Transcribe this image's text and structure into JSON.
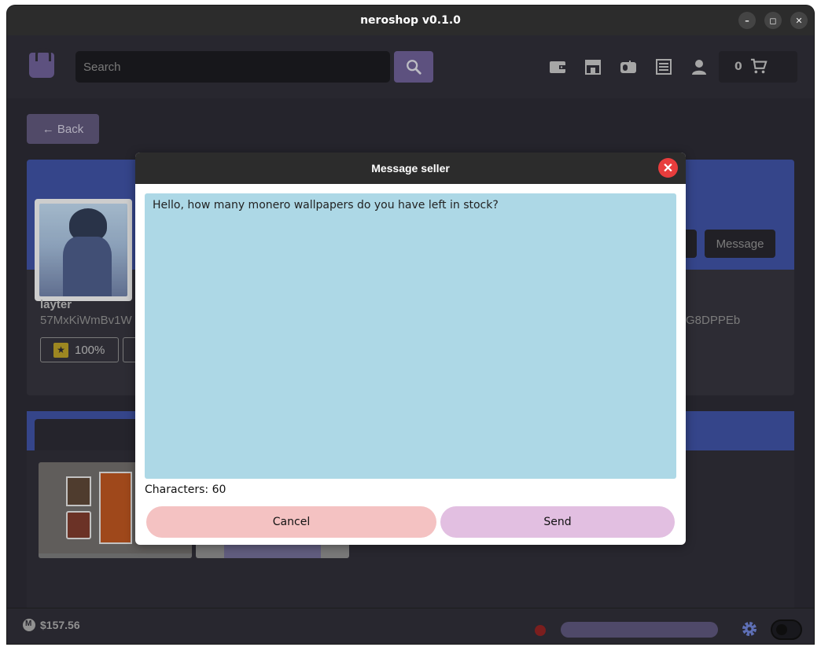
{
  "window": {
    "title": "neroshop v0.1.0",
    "controls": {
      "minimize": "–",
      "maximize": "◻",
      "close": "✕"
    }
  },
  "header": {
    "search_placeholder": "Search",
    "search_value": "",
    "cart_count": "0",
    "icons": [
      "wallet-icon",
      "store-icon",
      "mailbox-icon",
      "orders-icon",
      "account-icon",
      "cart-icon"
    ]
  },
  "page": {
    "back_label": "← Back",
    "seller": {
      "name": "layter",
      "id_start": "57MxKiWmBv1W",
      "id_end": "G8DPPEb",
      "rating": "100%",
      "message_button": "Message"
    }
  },
  "modal": {
    "title": "Message seller",
    "close_glyph": "✕",
    "message_value": "Hello, how many monero wallpapers do you have left in stock?",
    "char_count_label": "Characters:",
    "char_count_value": "60",
    "cancel_label": "Cancel",
    "send_label": "Send"
  },
  "statusbar": {
    "balance": "$157.56"
  },
  "colors": {
    "accent": "#6a5d91",
    "banner": "#3d4f9e",
    "textarea_bg": "#add8e6",
    "cancel_bg": "#f4c2c2",
    "send_bg": "#e2bfe1",
    "close_bg": "#e83d3d",
    "status_offline": "#8c2323"
  }
}
